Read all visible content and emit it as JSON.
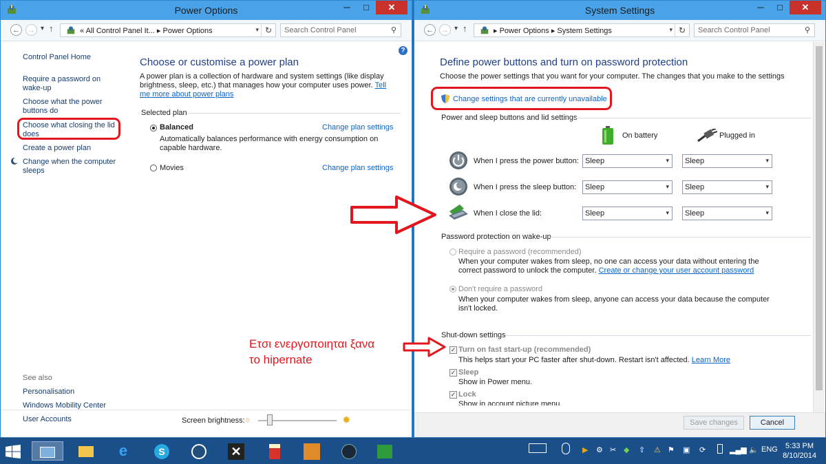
{
  "colors": {
    "accent": "#4aa3e8",
    "link": "#0a64c8",
    "annotation": "#e3161d",
    "taskbar": "#1b4f8a",
    "close": "#c8322b"
  },
  "power_options": {
    "title": "Power Options",
    "breadcrumb": {
      "sep": "«",
      "path1": "All Control Panel It...",
      "arrow": "▸",
      "path2": "Power Options"
    },
    "search_placeholder": "Search Control Panel",
    "sidebar": {
      "home": "Control Panel Home",
      "items": [
        "Require a password on wake-up",
        "Choose what the power buttons do",
        "Choose what closing the lid does",
        "Create a power plan",
        "Change when the computer sleeps"
      ],
      "see_also": "See also",
      "see_also_items": [
        "Personalisation",
        "Windows Mobility Center",
        "User Accounts"
      ]
    },
    "main": {
      "title": "Choose or customise a power plan",
      "desc": "A power plan is a collection of hardware and system settings (like display brightness, sleep, etc.) that manages how your computer uses power.",
      "tell_me": "Tell me more about power plans",
      "selected_plan": "Selected plan",
      "plans": [
        {
          "name": "Balanced",
          "desc": "Automatically balances performance with energy consumption on capable hardware.",
          "link": "Change plan settings"
        },
        {
          "name": "Movies",
          "link": "Change plan settings"
        }
      ],
      "brightness_label": "Screen brightness:"
    }
  },
  "system_settings": {
    "title": "System Settings",
    "breadcrumb": {
      "path1": "Power Options",
      "arrow": "▸",
      "path2": "System Settings"
    },
    "search_placeholder": "Search Control Panel",
    "heading": "Define power buttons and turn on password protection",
    "desc": "Choose the power settings that you want for your computer. The changes that you make to the settings on this page apply to all of your power plans.",
    "change_link": "Change settings that are currently unavailable",
    "buttons_section": "Power and sleep buttons and lid settings",
    "col_battery": "On battery",
    "col_plugged": "Plugged in",
    "rows": [
      {
        "label": "When I press the power button:",
        "battery": "Sleep",
        "plugged": "Sleep"
      },
      {
        "label": "When I press the sleep button:",
        "battery": "Sleep",
        "plugged": "Sleep"
      },
      {
        "label": "When I close the lid:",
        "battery": "Sleep",
        "plugged": "Sleep"
      }
    ],
    "password_section": "Password protection on wake-up",
    "require_label": "Require a password (recommended)",
    "require_desc": "When your computer wakes from sleep, no one can access your data without entering the correct password to unlock the computer.",
    "require_link": "Create or change your user account password",
    "dont_label": "Don't require a password",
    "dont_desc": "When your computer wakes from sleep, anyone can access your data because the computer isn't locked.",
    "shutdown_section": "Shut-down settings",
    "fast_label": "Turn on fast start-up (recommended)",
    "fast_desc": "This helps start your PC faster after shut-down. Restart isn't affected.",
    "fast_link": "Learn More",
    "sleep_label": "Sleep",
    "sleep_desc": "Show in Power menu.",
    "lock_label": "Lock",
    "lock_desc": "Show in account picture menu.",
    "save": "Save changes",
    "cancel": "Cancel"
  },
  "annotation": {
    "line1": "Ετσι ενεργοποιηται ξανα",
    "line2": "το hipernate"
  },
  "taskbar": {
    "lang": "ENG",
    "time": "5:33 PM",
    "date": "8/10/2014"
  }
}
